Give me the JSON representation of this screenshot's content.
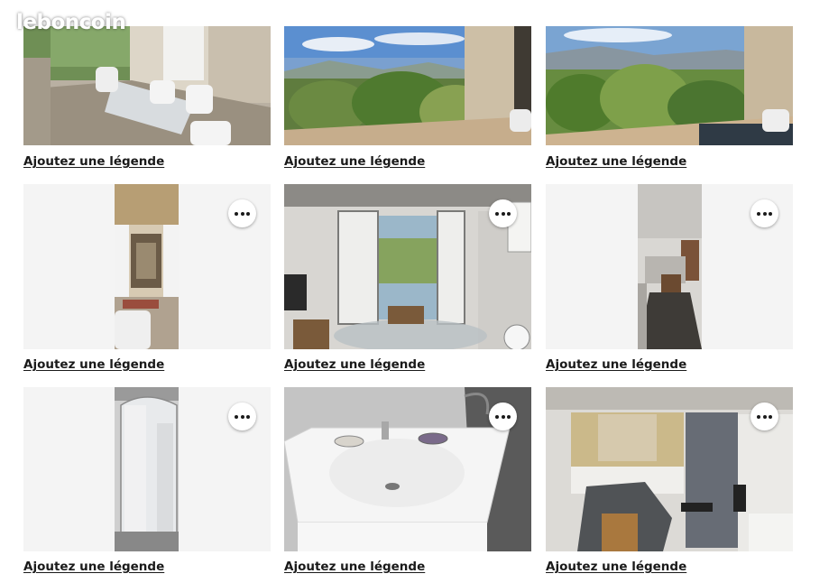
{
  "watermark": "leboncoin",
  "caption_label": "Ajoutez une légende",
  "photos": [
    {
      "caption": "Ajoutez une légende",
      "has_menu": false
    },
    {
      "caption": "Ajoutez une légende",
      "has_menu": false
    },
    {
      "caption": "Ajoutez une légende",
      "has_menu": false
    },
    {
      "caption": "Ajoutez une légende",
      "has_menu": true
    },
    {
      "caption": "Ajoutez une légende",
      "has_menu": true
    },
    {
      "caption": "Ajoutez une légende",
      "has_menu": true
    },
    {
      "caption": "Ajoutez une légende",
      "has_menu": true
    },
    {
      "caption": "Ajoutez une légende",
      "has_menu": true
    },
    {
      "caption": "Ajoutez une légende",
      "has_menu": true
    }
  ],
  "menu_icon": "more-horizontal-icon"
}
